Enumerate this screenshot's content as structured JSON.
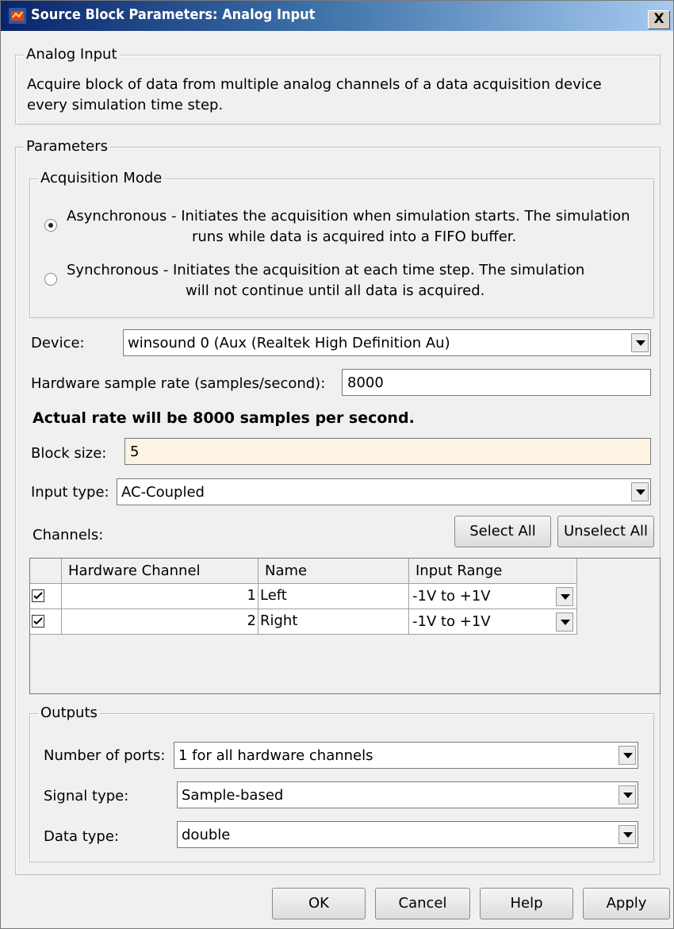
{
  "window": {
    "title": "Source Block Parameters: Analog Input",
    "close_label": "X"
  },
  "description": {
    "group_label": "Analog Input",
    "line1": "Acquire block of data from multiple analog channels of a data acquisition device",
    "line2": "every simulation time step."
  },
  "parameters": {
    "group_label": "Parameters",
    "acquisition_mode": {
      "group_label": "Acquisition Mode",
      "async_line1": "Asynchronous - Initiates the acquisition when simulation starts. The simulation",
      "async_line2": "runs while data is acquired into a FIFO buffer.",
      "sync_line1": "Synchronous  - Initiates the acquisition at each time step. The simulation",
      "sync_line2": "will not continue until all data is acquired.",
      "selected": "Asynchronous"
    },
    "device": {
      "label": "Device:",
      "value": "winsound 0 (Aux (Realtek High Definition Au)"
    },
    "sample_rate": {
      "label": "Hardware sample rate (samples/second):",
      "value": "8000"
    },
    "actual_rate_text": "Actual rate will be 8000 samples per second.",
    "block_size": {
      "label": "Block size:",
      "value": "5"
    },
    "input_type": {
      "label": "Input type:",
      "value": "AC-Coupled"
    },
    "channels": {
      "label": "Channels:",
      "select_all": "Select All",
      "unselect_all": "Unselect All",
      "columns": [
        "Hardware Channel",
        "Name",
        "Input Range"
      ],
      "rows": [
        {
          "checked": true,
          "hardware_channel": "1",
          "name": "Left",
          "input_range": "-1V to +1V"
        },
        {
          "checked": true,
          "hardware_channel": "2",
          "name": "Right",
          "input_range": "-1V to +1V"
        }
      ]
    },
    "outputs": {
      "group_label": "Outputs",
      "num_ports": {
        "label": "Number of ports:",
        "value": "1 for all hardware channels"
      },
      "signal_type": {
        "label": "Signal type:",
        "value": "Sample-based"
      },
      "data_type": {
        "label": "Data type:",
        "value": "double"
      }
    }
  },
  "buttons": {
    "ok": "OK",
    "cancel": "Cancel",
    "help": "Help",
    "apply": "Apply"
  },
  "colors": {
    "title_start": "#0a246a",
    "title_end": "#a6caf0",
    "highlight_field": "#fdf3e3",
    "dialog_bg": "#f0f0f0"
  }
}
